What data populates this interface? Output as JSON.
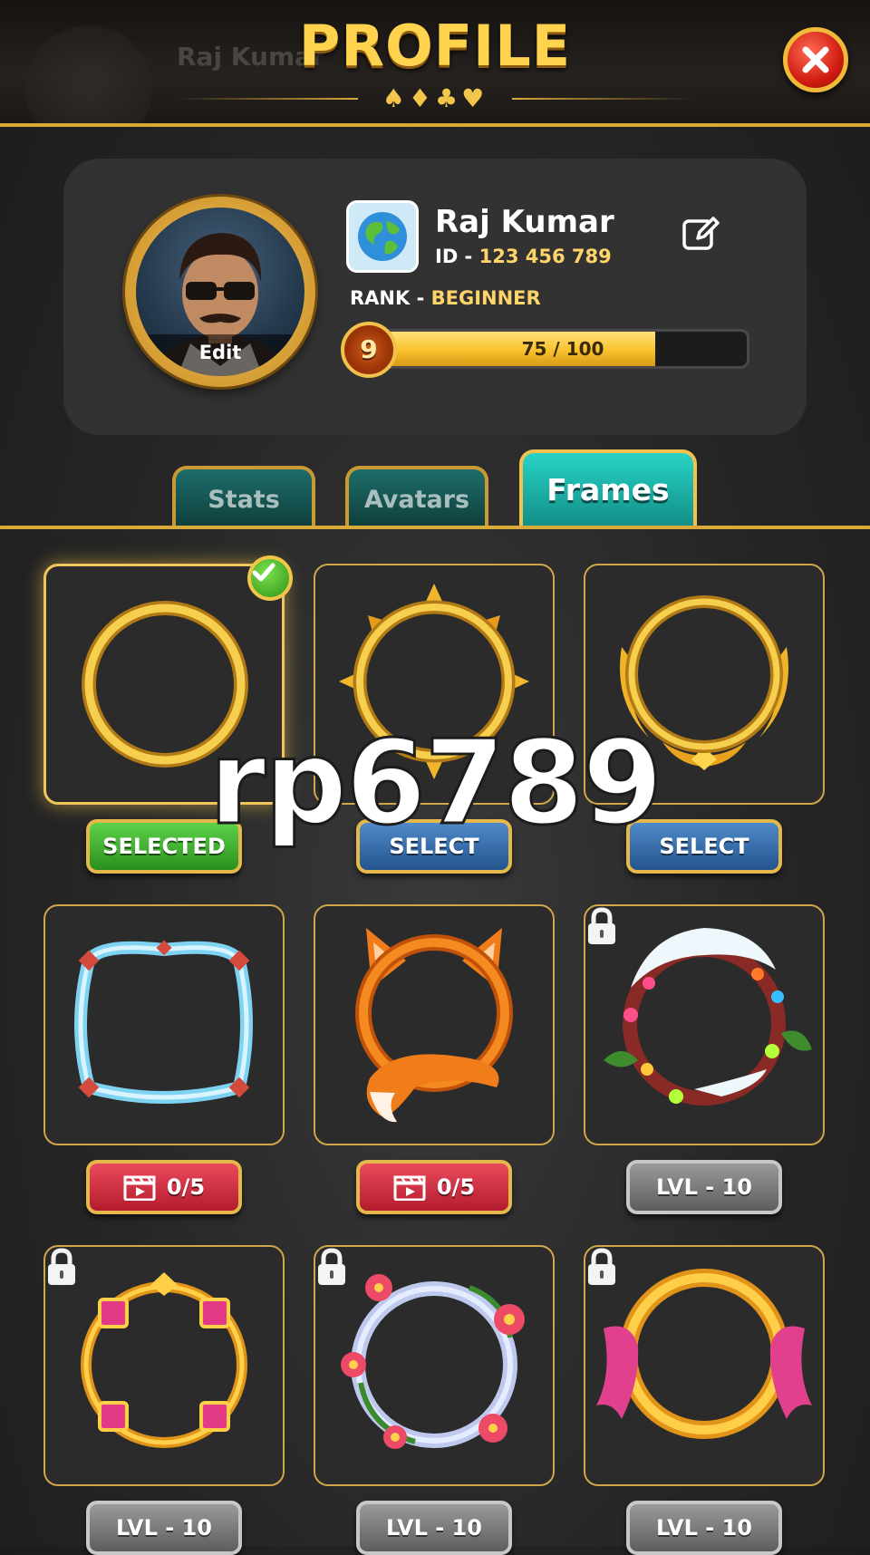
{
  "header": {
    "title": "PROFILE",
    "background_name": "Raj Kumar",
    "suits": "♠♦♣♥"
  },
  "profile": {
    "name": "Raj Kumar",
    "avatar_edit_label": "Edit",
    "id_label": "ID - ",
    "id_value": "123 456 789",
    "rank_label": "RANK - ",
    "rank_value": "BEGINNER",
    "level": "9",
    "xp_text": "75 / 100",
    "xp_fraction": 0.75
  },
  "tabs": [
    {
      "label": "Stats",
      "active": false
    },
    {
      "label": "Avatars",
      "active": false
    },
    {
      "label": "Frames",
      "active": true
    }
  ],
  "frames": [
    {
      "name": "Gold Ring",
      "button": "SELECTED",
      "style": "green",
      "selected": true,
      "locked": false
    },
    {
      "name": "Sun Spikes",
      "button": "SELECT",
      "style": "blue",
      "selected": false,
      "locked": false
    },
    {
      "name": "Golden Wings",
      "button": "SELECT",
      "style": "blue",
      "selected": false,
      "locked": false
    },
    {
      "name": "Ice Crystal",
      "button": "0/5",
      "style": "red",
      "selected": false,
      "locked": false,
      "icon": "clapperboard-icon"
    },
    {
      "name": "Fox",
      "button": "0/5",
      "style": "red",
      "selected": false,
      "locked": false,
      "icon": "clapperboard-icon"
    },
    {
      "name": "Winter Wreath",
      "button": "LVL - 10",
      "style": "gray",
      "selected": false,
      "locked": true
    },
    {
      "name": "Ruby Ornate",
      "button": "LVL - 10",
      "style": "gray",
      "selected": false,
      "locked": true
    },
    {
      "name": "Flower Wreath",
      "button": "LVL - 10",
      "style": "gray",
      "selected": false,
      "locked": true
    },
    {
      "name": "Pink Ribbon",
      "button": "LVL - 10",
      "style": "gray",
      "selected": false,
      "locked": true
    }
  ],
  "watermark": "rp6789",
  "colors": {
    "gold": "#d9a93a",
    "teal_active": "#2ad3c6",
    "green": "#3ca82a",
    "blue": "#3a6ead",
    "red": "#d12d42",
    "gray": "#7a7a7a"
  }
}
